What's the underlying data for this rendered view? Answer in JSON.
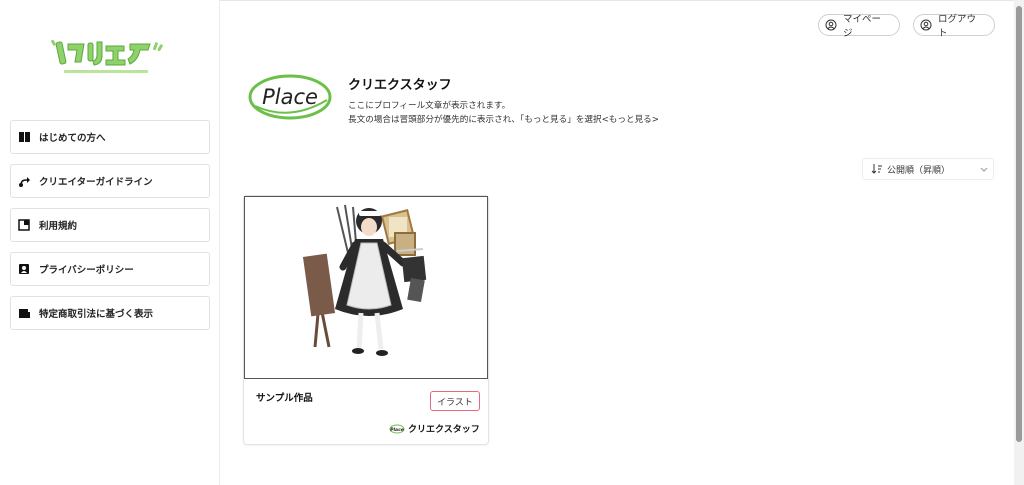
{
  "brand": {
    "logo_alt": "クリエクフ",
    "accent": "#7cc94a"
  },
  "sidebar": {
    "items": [
      {
        "label": "はじめての方へ",
        "icon": "book-icon"
      },
      {
        "label": "クリエイターガイドライン",
        "icon": "route-icon"
      },
      {
        "label": "利用規約",
        "icon": "document-icon"
      },
      {
        "label": "プライバシーポリシー",
        "icon": "shield-person-icon"
      },
      {
        "label": "特定商取引法に基づく表示",
        "icon": "folder-icon"
      }
    ]
  },
  "header": {
    "mypage_label": "マイページ",
    "logout_label": "ログアウト"
  },
  "profile": {
    "logo_text": "Place",
    "name": "クリエクスタッフ",
    "desc_line1": "ここにプロフィール文章が表示されます。",
    "desc_line2": "長文の場合は冒頭部分が優先的に表示され、「もっと見る」を選択<もっと見る>"
  },
  "sort": {
    "selected": "公開順（昇順）"
  },
  "works": [
    {
      "title": "サンプル作品",
      "tag": "イラスト",
      "author": "クリエクスタッフ",
      "author_logo_text": "Place"
    }
  ],
  "colors": {
    "tag_border": "#e26b7c",
    "logo_green": "#7cc94a"
  }
}
